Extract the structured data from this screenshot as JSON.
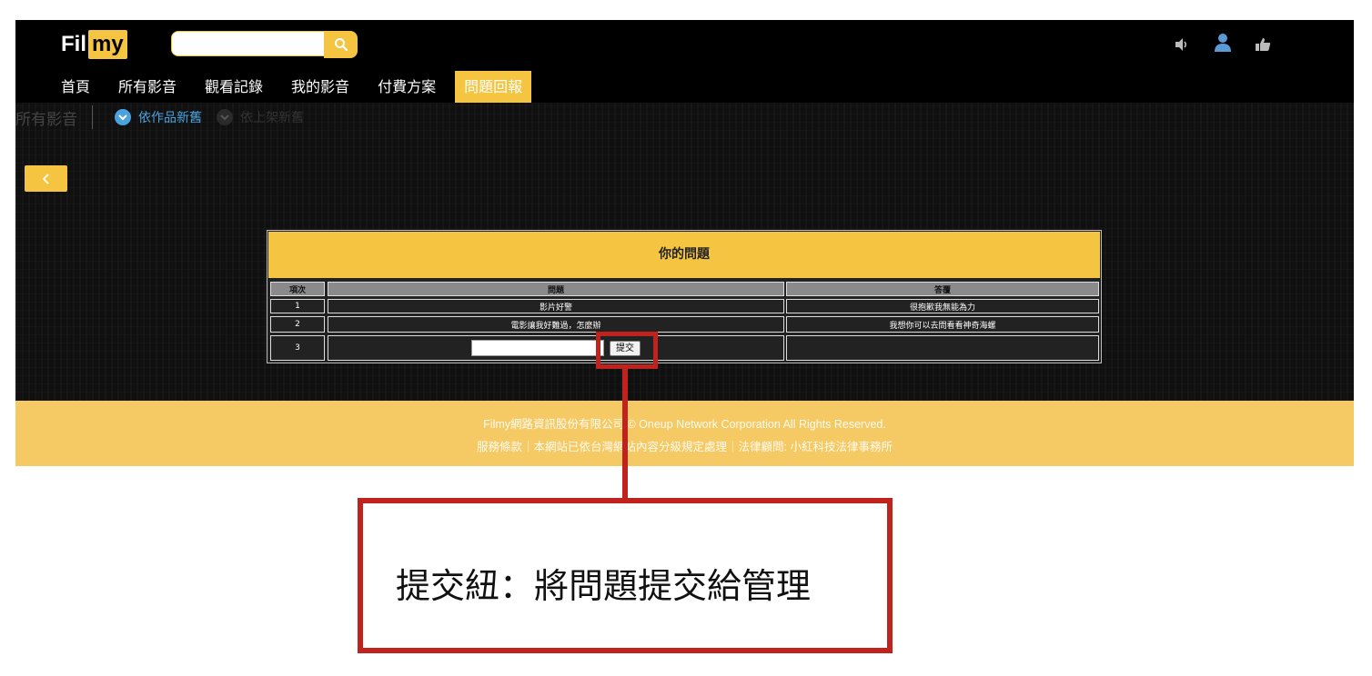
{
  "logo": {
    "part1": "Fil",
    "part2": "my"
  },
  "search": {
    "placeholder": ""
  },
  "nav": [
    {
      "label": "首頁"
    },
    {
      "label": "所有影音"
    },
    {
      "label": "觀看記錄"
    },
    {
      "label": "我的影音"
    },
    {
      "label": "付費方案"
    },
    {
      "label": "問題回報",
      "active": true
    }
  ],
  "sort_bar": {
    "title": "所有影音",
    "options": [
      {
        "label": "依作品新舊",
        "selected": true
      },
      {
        "label": "依上架新舊",
        "selected": false
      }
    ]
  },
  "qa_table": {
    "title": "你的問題",
    "headers": [
      "項次",
      "問題",
      "答覆"
    ],
    "rows": [
      {
        "index": "1",
        "question": "影片好警",
        "answer": "很抱歉我無能為力"
      },
      {
        "index": "2",
        "question": "電影讓我好難過，怎麼辦",
        "answer": "我想你可以去問看看神奇海螺"
      },
      {
        "index": "3",
        "question": "",
        "answer": ""
      }
    ],
    "submit_label": "提交"
  },
  "footer": {
    "line1": "Filmy網路資訊股份有限公司 © Oneup Network Corporation All Rights Reserved.",
    "line2": "服務條款｜本網站已依台灣網站內容分級規定處理｜法律顧問: 小紅科技法律事務所"
  },
  "callout": {
    "text": "提交紐：將問題提交給管理"
  },
  "colors": {
    "accent": "#f5c542",
    "footer": "#f5ca64",
    "annotation": "#c0221d",
    "sort_selected": "#4aa3df"
  },
  "icons": [
    "search-icon",
    "speaker-icon",
    "user-icon",
    "thumbs-up-icon",
    "chevron-left-icon",
    "chevron-down-icon"
  ]
}
